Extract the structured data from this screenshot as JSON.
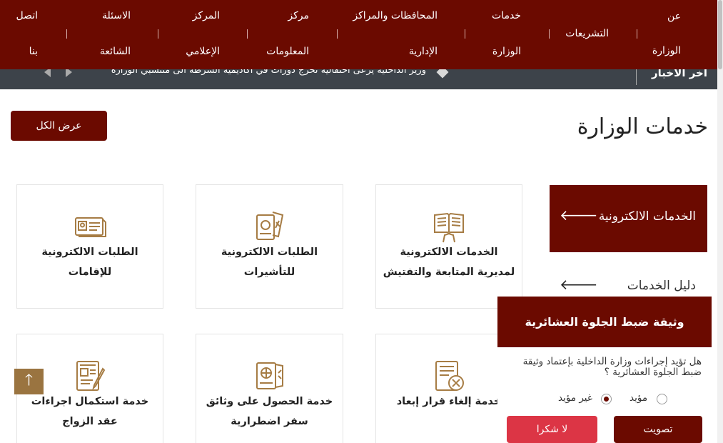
{
  "nav": {
    "items": [
      {
        "line1": "عن",
        "line2": "الوزارة"
      },
      {
        "line1": "التشريعات",
        "line2": ""
      },
      {
        "line1": "خدمات",
        "line2": "الوزارة"
      },
      {
        "line1": "المحافظات والمراكز",
        "line2": "الإدارية"
      },
      {
        "line1": "مركز",
        "line2": "المعلومات"
      },
      {
        "line1": "المركز",
        "line2": "الإعلامي"
      },
      {
        "line1": "الاسئلة",
        "line2": "الشائعة"
      },
      {
        "line1": "اتصل",
        "line2": "بنا"
      }
    ]
  },
  "ticker": {
    "title": "آخر الأخبار",
    "text": "وزير الداخلية يرعى احتفالية تخرج دورات في أكاديمية الشرطة الى منتسبي الوزارة"
  },
  "section": {
    "title": "خدمات الوزارة",
    "view_all": "عرض الكل"
  },
  "side_menu": {
    "active": "الخدمات الالكترونية",
    "item2": "دليل الخدمات"
  },
  "cards": [
    {
      "line1": "الخدمات الالكترونية",
      "line2": "لمديرية المتابعة والتفتيش",
      "icon": "reading-book-icon"
    },
    {
      "line1": "الطلبات الالكترونية",
      "line2": "للتأشيرات",
      "icon": "passport-visa-icon"
    },
    {
      "line1": "الطلبات الالكترونية",
      "line2": "للإقامات",
      "icon": "id-card-icon"
    },
    {
      "line1": "خدمة إلغاء قرار إبعاد",
      "line2": "",
      "icon": "cancel-document-icon"
    },
    {
      "line1": "خدمة الحصول على وثائق",
      "line2": "سفر اضطرارية",
      "icon": "passport-travel-icon"
    },
    {
      "line1": "خدمة استكمال اجراءات",
      "line2": "عقد الزواج",
      "icon": "form-pen-icon"
    }
  ],
  "poll": {
    "title": "وثيقة ضبط الجلوة العشائرية",
    "question": "هل تؤيد إجراءات وزارة الداخلية بإعتماد وثيقة ضبط الجلوة العشائرية ؟",
    "option_yes": "مؤيد",
    "option_no": "غير مؤيد",
    "selected": "غير مؤيد",
    "vote_button": "تصويت",
    "dismiss_button": "لا شكرا"
  },
  "colors": {
    "brand": "#6b0a00",
    "ticker_bg": "#3d434a",
    "icon_gold": "#a67c44",
    "danger": "#dc3545"
  }
}
